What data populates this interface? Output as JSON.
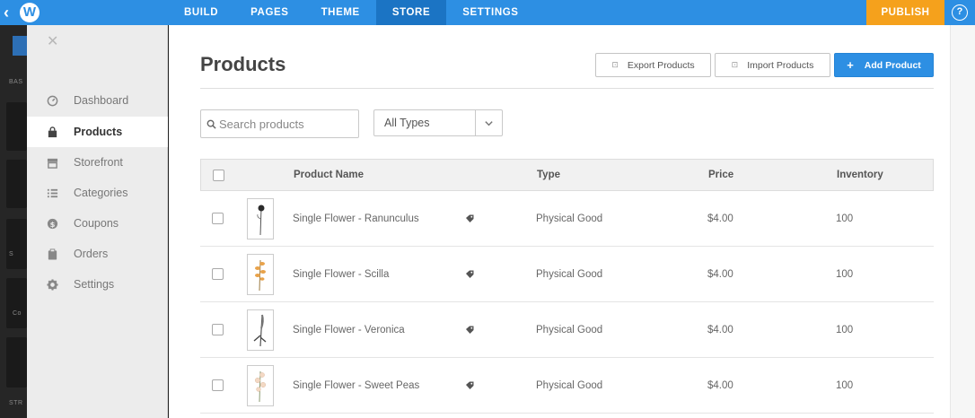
{
  "topbar": {
    "nav": [
      "BUILD",
      "PAGES",
      "THEME",
      "STORE",
      "SETTINGS"
    ],
    "active_nav": "STORE",
    "publish_label": "PUBLISH",
    "help_label": "?",
    "logo_letter": "W"
  },
  "background_editor": {
    "labels": [
      "BAS",
      "S",
      "Co",
      "STR"
    ]
  },
  "sidebar": {
    "items": [
      {
        "label": "Dashboard",
        "icon": "dashboard-icon"
      },
      {
        "label": "Products",
        "icon": "bag-icon",
        "active": true
      },
      {
        "label": "Storefront",
        "icon": "storefront-icon"
      },
      {
        "label": "Categories",
        "icon": "list-icon"
      },
      {
        "label": "Coupons",
        "icon": "dollar-icon"
      },
      {
        "label": "Orders",
        "icon": "clipboard-icon"
      },
      {
        "label": "Settings",
        "icon": "gear-icon"
      }
    ]
  },
  "main": {
    "title": "Products",
    "buttons": {
      "export": "Export Products",
      "import": "Import Products",
      "add": "Add Product"
    },
    "search_placeholder": "Search products",
    "type_filter": "All Types",
    "columns": {
      "name": "Product Name",
      "type": "Type",
      "price": "Price",
      "inventory": "Inventory"
    },
    "rows": [
      {
        "name": "Single Flower - Ranunculus",
        "type": "Physical Good",
        "price": "$4.00",
        "inventory": "100",
        "flower": "dark"
      },
      {
        "name": "Single Flower - Scilla",
        "type": "Physical Good",
        "price": "$4.00",
        "inventory": "100",
        "flower": "orange"
      },
      {
        "name": "Single Flower - Veronica",
        "type": "Physical Good",
        "price": "$4.00",
        "inventory": "100",
        "flower": "grey"
      },
      {
        "name": "Single Flower - Sweet Peas",
        "type": "Physical Good",
        "price": "$4.00",
        "inventory": "100",
        "flower": "peach"
      }
    ]
  },
  "colors": {
    "accent": "#2d8fe3",
    "active_nav": "#1b74c4",
    "publish": "#f5a11c"
  }
}
